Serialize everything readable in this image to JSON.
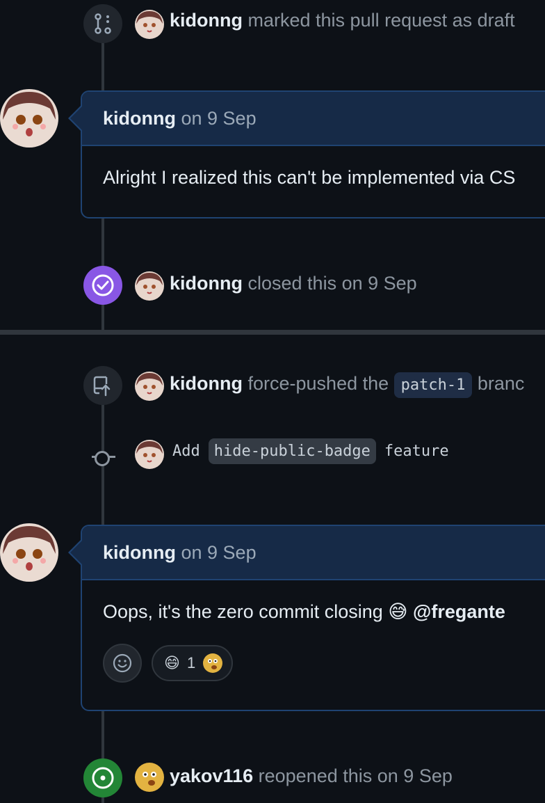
{
  "events": {
    "draft": {
      "user": "kidonng",
      "action": "marked this pull request as draft"
    },
    "closed": {
      "user": "kidonng",
      "action": "closed this on 9 Sep"
    },
    "force_push": {
      "user": "kidonng",
      "action": "force-pushed the",
      "branch": "patch-1",
      "suffix": "branc"
    },
    "reopened": {
      "user": "yakov116",
      "action": "reopened this on 9 Sep"
    }
  },
  "commit": {
    "prefix": "Add",
    "code": "hide-public-badge",
    "suffix": "feature"
  },
  "comments": [
    {
      "user": "kidonng",
      "date": "on 9 Sep",
      "body": "Alright I realized this can't be implemented via CS"
    },
    {
      "user": "kidonng",
      "date": "on 9 Sep",
      "body": "Oops, it's the zero commit closing",
      "mention": "@fregante",
      "reactions": {
        "emoji": "😄",
        "count": "1"
      }
    }
  ],
  "colors": {
    "merged_purple": "#8957e5",
    "open_green": "#238636",
    "comment_border": "#1f4372"
  }
}
